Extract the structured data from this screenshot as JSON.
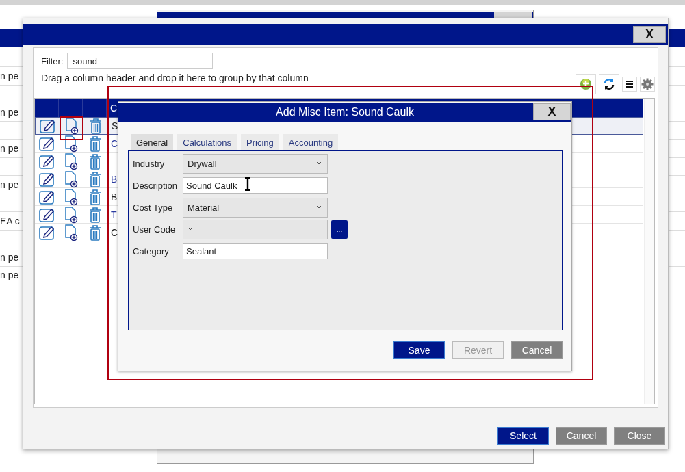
{
  "background": {
    "rows": [
      {
        "kind": "text",
        "text": "n pe"
      },
      {
        "kind": "blank"
      },
      {
        "kind": "text",
        "text": "n pe"
      },
      {
        "kind": "blank"
      },
      {
        "kind": "text",
        "text": "n pe"
      },
      {
        "kind": "blank"
      },
      {
        "kind": "text",
        "text": "n pe"
      },
      {
        "kind": "blank"
      },
      {
        "kind": "text",
        "text": "EA c"
      },
      {
        "kind": "blank"
      },
      {
        "kind": "text",
        "text": "n pe"
      },
      {
        "kind": "text",
        "text": "n pe"
      }
    ]
  },
  "main_window": {
    "close": "X",
    "filter_label": "Filter:",
    "filter_value": "sound",
    "group_hint": "Drag a column header and drop it here to group by that column",
    "grid": {
      "header": "C",
      "rows": [
        {
          "selected": true,
          "link": false,
          "cell": "S"
        },
        {
          "selected": false,
          "link": true,
          "cell": "C"
        },
        {
          "selected": false
        },
        {
          "selected": false,
          "link": true,
          "cell": "B"
        },
        {
          "selected": false,
          "link": false,
          "cell": "B"
        },
        {
          "selected": false,
          "link": true,
          "cell": "T"
        },
        {
          "selected": false,
          "link": false,
          "cell": "C"
        }
      ]
    },
    "buttons": [
      {
        "label": "Select",
        "kind": "primary"
      },
      {
        "label": "Cancel",
        "kind": "secondary"
      },
      {
        "label": "Close",
        "kind": "secondary"
      }
    ]
  },
  "dialog": {
    "title": "Add Misc Item: Sound Caulk",
    "close": "X",
    "tabs": [
      {
        "label": "General",
        "selected": true
      },
      {
        "label": "Calculations",
        "selected": false
      },
      {
        "label": "Pricing",
        "selected": false
      },
      {
        "label": "Accounting",
        "selected": false
      }
    ],
    "fields": [
      {
        "label": "Industry",
        "kind": "dropdown",
        "value": "Drywall"
      },
      {
        "label": "Description",
        "kind": "text",
        "value": "Sound Caulk"
      },
      {
        "label": "Cost Type",
        "kind": "dropdown",
        "value": "Material"
      },
      {
        "label": "User Code",
        "kind": "dropdown",
        "lookup": "..."
      },
      {
        "label": "Category",
        "kind": "text",
        "value": "Sealant"
      }
    ],
    "buttons": [
      {
        "label": "Save",
        "kind": "primary",
        "disabled": false
      },
      {
        "label": "Revert",
        "kind": "secondary",
        "disabled": true
      },
      {
        "label": "Cancel",
        "kind": "secondary",
        "disabled": false
      }
    ]
  }
}
